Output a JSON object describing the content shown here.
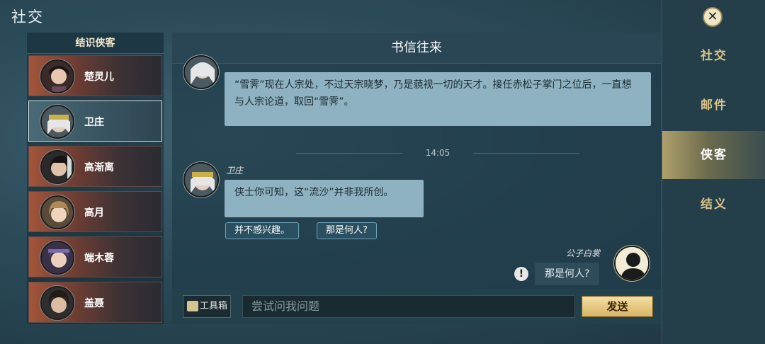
{
  "window": {
    "title": "社交"
  },
  "contacts": {
    "header": "结识侠客",
    "items": [
      {
        "name": "楚灵儿"
      },
      {
        "name": "卫庄"
      },
      {
        "name": "高渐离"
      },
      {
        "name": "高月"
      },
      {
        "name": "端木蓉"
      },
      {
        "name": "盖聂"
      }
    ]
  },
  "chat": {
    "title": "书信往来",
    "messages": [
      {
        "text": "“雪霁”现在人宗处，不过天宗晓梦，乃是藐视一切的天才。接任赤松子掌门之位后，一直想与人宗论道，取回“雪霁”。"
      },
      {
        "sender": "卫庄",
        "text": "侠士你可知，这“流沙”并非我所创。"
      }
    ],
    "timestamp": "14:05",
    "options": [
      "并不感兴趣。",
      "那是何人?"
    ],
    "my_message": {
      "sender": "公子白裳",
      "text": "那是何人?",
      "alert": "!"
    },
    "toolbox_label": "工具箱",
    "input_placeholder": "尝试问我问题",
    "send_label": "发送"
  },
  "nav": {
    "close": "✕",
    "items": [
      "社交",
      "邮件",
      "侠客",
      "结义"
    ],
    "active": "侠客"
  },
  "colors": {
    "accent_gold": "#d8c48a",
    "bubble": "#8fb2c2",
    "contact_active": "#a3553b"
  }
}
